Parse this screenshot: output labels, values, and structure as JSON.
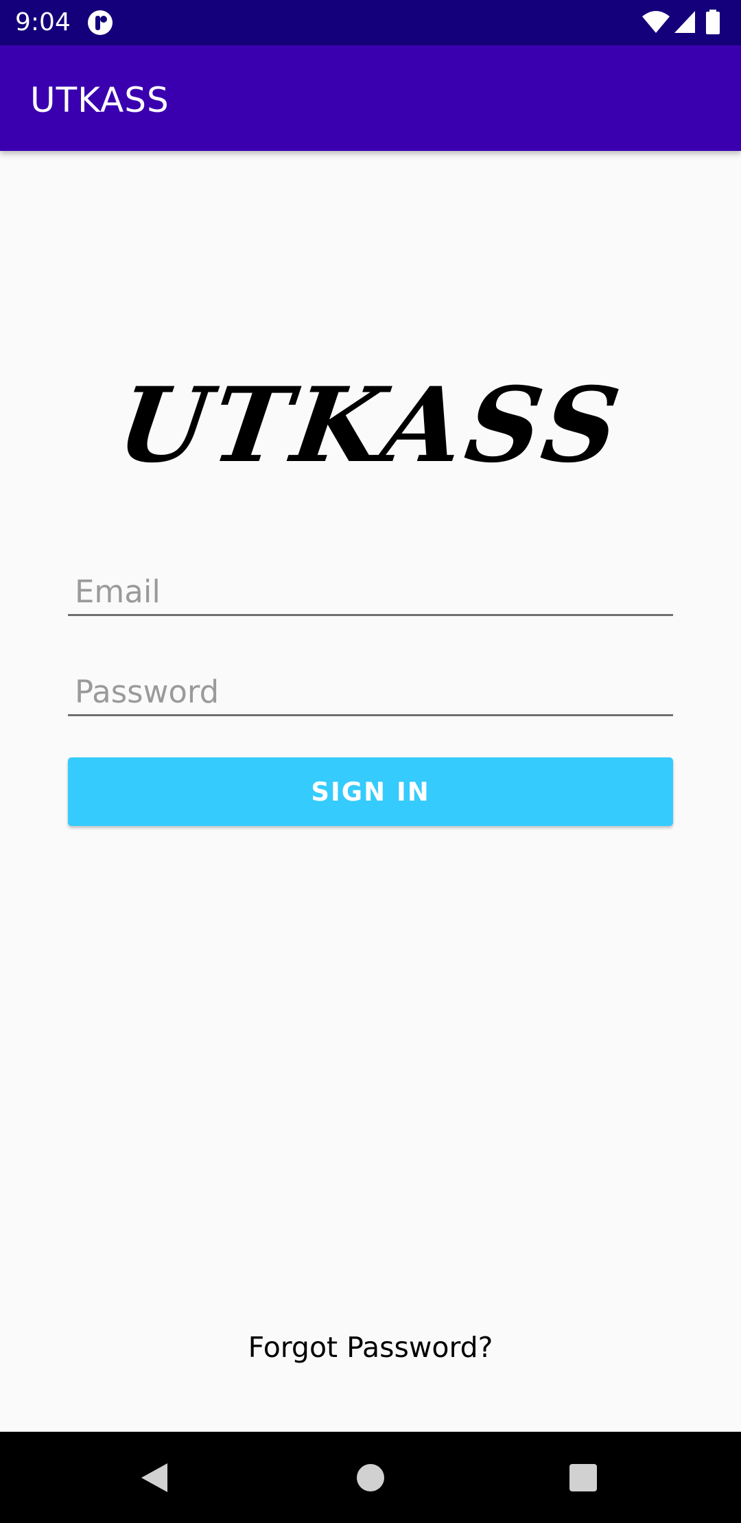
{
  "status_bar": {
    "time": "9:04",
    "icons": [
      "app-notification-icon",
      "wifi-icon",
      "cell-signal-icon",
      "battery-icon"
    ]
  },
  "app_bar": {
    "title": "UTKASS"
  },
  "logo": {
    "text": "UTKASS"
  },
  "form": {
    "email_placeholder": "Email",
    "email_value": "",
    "password_placeholder": "Password",
    "password_value": "",
    "sign_in_label": "SIGN IN"
  },
  "forgot_password": "Forgot Password?",
  "nav_bar": {
    "icons": [
      "back-icon",
      "home-icon",
      "recents-icon"
    ]
  },
  "colors": {
    "status_bar": "#14007a",
    "app_bar": "#3a00b0",
    "button": "#35cbfd",
    "background": "#fafafa"
  }
}
